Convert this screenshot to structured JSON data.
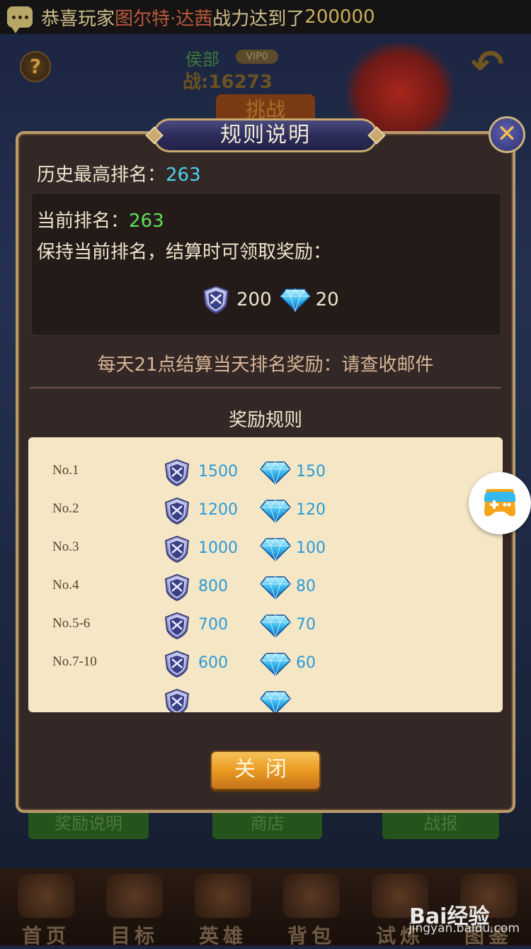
{
  "background": {
    "marquee": {
      "prefix": "恭喜玩家",
      "player": "图尔特·达茜",
      "middle": "战力达到了",
      "value": "200000"
    },
    "help_icon": "?",
    "opponent": {
      "title": "侯部",
      "vip": "VIP0",
      "power": "战:16273"
    },
    "challenge_label": "挑战",
    "buttons": [
      "奖励说明",
      "商店",
      "战报"
    ],
    "nav": [
      "首页",
      "目标",
      "英雄",
      "背包",
      "试炼",
      "图鉴"
    ]
  },
  "dialog": {
    "title": "规则说明",
    "close_icon": "close-x",
    "history_label": "历史最高排名：",
    "history_value": "263",
    "current_label": "当前排名：",
    "current_value": "263",
    "keep_text": "保持当前排名，结算时可领取奖励：",
    "current_reward": {
      "medal": "200",
      "gem": "20"
    },
    "daily_note": "每天21点结算当天排名奖励：请查收邮件",
    "rules_title": "奖励规则",
    "rules": [
      {
        "rank": "No.1",
        "medal": "1500",
        "gem": "150"
      },
      {
        "rank": "No.2",
        "medal": "1200",
        "gem": "120"
      },
      {
        "rank": "No.3",
        "medal": "1000",
        "gem": "100"
      },
      {
        "rank": "No.4",
        "medal": "800",
        "gem": "80"
      },
      {
        "rank": "No.5-6",
        "medal": "700",
        "gem": "70"
      },
      {
        "rank": "No.7-10",
        "medal": "600",
        "gem": "60"
      }
    ],
    "close_button": "关闭"
  },
  "watermark": {
    "main": "Bai经验",
    "sub": "jingyan.baidu.com"
  },
  "colors": {
    "accent_blue": "#2a9ad8",
    "current_green": "#5de25a",
    "history_cyan": "#4fd0ee",
    "button_gold": "#e99a22"
  }
}
